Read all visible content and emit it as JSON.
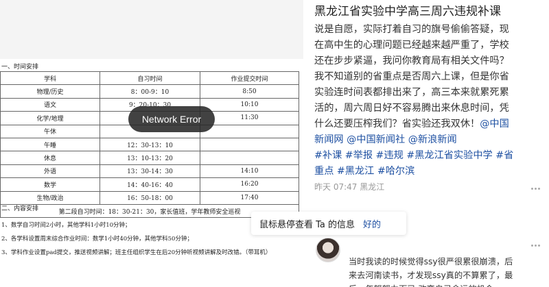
{
  "image": {
    "section1": "一、时间安排",
    "table": {
      "headers": [
        "学科",
        "自习时间",
        "作业提交时间"
      ],
      "rows": [
        [
          "物理/历史",
          "8：00-9：10",
          "8:50"
        ],
        [
          "语文",
          "9：20-10：30",
          "10:10"
        ],
        [
          "化学/地理",
          "",
          "11:30"
        ],
        [
          "午休",
          "",
          ""
        ],
        [
          "午睡",
          "12：30-13：10",
          ""
        ],
        [
          "休息",
          "13：10-13：20",
          ""
        ],
        [
          "外语",
          "13：30-14：30",
          "14:10"
        ],
        [
          "数学",
          "14：40-16：40",
          "16:20"
        ],
        [
          "生物/政治",
          "16：50-18：00",
          "17:40"
        ]
      ],
      "footer": "第二段自习时间：18：30-21：30，家长值班，学年教师安全巡视"
    },
    "section2": "二、内容安排",
    "items": [
      "1、数学自习时间2小时，其他学科1小时10分钟；",
      "2、各学科设置周末综合作业时间：数学1小时40分钟，其他学科50分钟；",
      "3、学科作业设置pad提交，推送视频讲解；班主任组织学生在后20分钟听视频讲解及时改错。（带耳机）"
    ],
    "error": "Network Error"
  },
  "post": {
    "title": "黑龙江省实验中学高三周六违规补课",
    "lines": [
      [
        {
          "t": "说是自愿，实际打着自习的旗号偷偷答疑，现"
        }
      ],
      [
        {
          "t": "在高中生的心理问题已经越来越严重了，学校"
        }
      ],
      [
        {
          "t": "还在步步紧逼，我问你教育局有相关文件吗？"
        }
      ],
      [
        {
          "t": "我不知道别的省重点是否周六上课，但是你省"
        }
      ],
      [
        {
          "t": "实验连时间表都排出来了，高三本来就累死累"
        }
      ],
      [
        {
          "t": "活的，周六周日好不容易腾出来休息时间，凭"
        }
      ],
      [
        {
          "t": "什么还要压榨我们？省实验还我双休！"
        },
        {
          "t": "@中国",
          "tag": true
        }
      ],
      [
        {
          "t": "新闻网 @中国新闻社 @新浪新闻",
          "tag": true
        }
      ],
      [
        {
          "t": "#补课 #举报 #违规 #黑龙江省实验中学 #省",
          "tag": true
        }
      ],
      [
        {
          "t": "重点 #黑龙江 #哈尔滨",
          "tag": true
        }
      ]
    ],
    "meta": "昨天 07:47 黑龙江"
  },
  "hover_tip": {
    "text": "鼠标悬停查看 Ta 的信息",
    "ok": "好的"
  },
  "comment": {
    "lines": [
      "当时我读的时候觉得ssy很严很累很崩溃，后",
      "来去河南读书，才发现ssy真的不算累了，最",
      "后一年努努力而已,改变自己命运的机会"
    ]
  }
}
